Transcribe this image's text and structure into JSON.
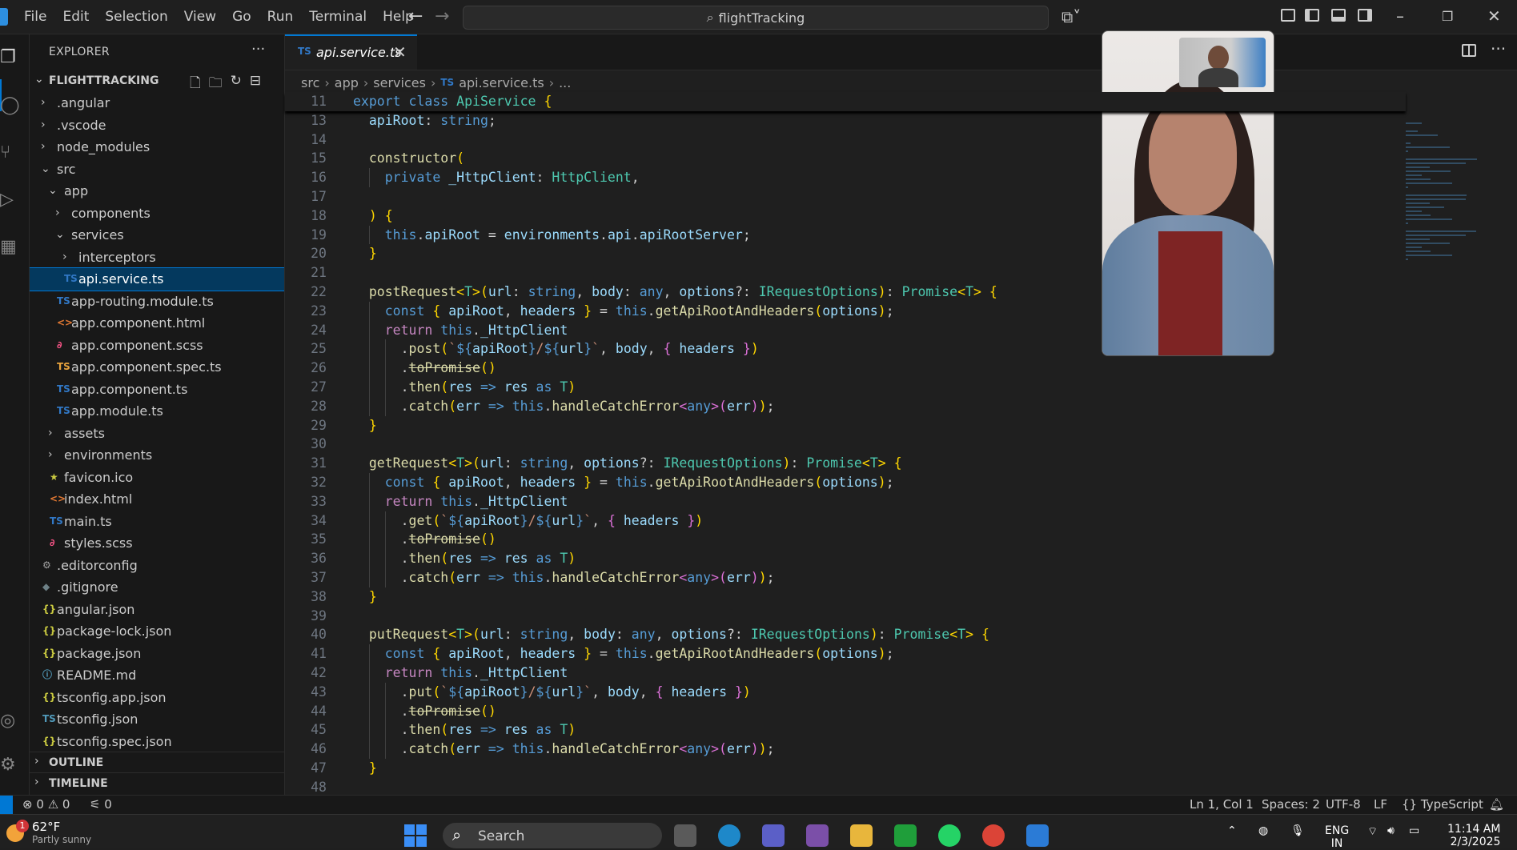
{
  "menu": [
    "File",
    "Edit",
    "Selection",
    "View",
    "Go",
    "Run",
    "Terminal",
    "Help"
  ],
  "command_center": {
    "text": "flightTracking"
  },
  "explorer": {
    "title": "EXPLORER",
    "root": "FLIGHTTRACKING",
    "items": [
      {
        "name": ".angular",
        "type": "folder",
        "depth": 1,
        "expanded": false
      },
      {
        "name": ".vscode",
        "type": "folder",
        "depth": 1,
        "expanded": false
      },
      {
        "name": "node_modules",
        "type": "folder",
        "depth": 1,
        "expanded": false
      },
      {
        "name": "src",
        "type": "folder",
        "depth": 1,
        "expanded": true
      },
      {
        "name": "app",
        "type": "folder",
        "depth": 2,
        "expanded": true
      },
      {
        "name": "components",
        "type": "folder",
        "depth": 3,
        "expanded": false
      },
      {
        "name": "services",
        "type": "folder",
        "depth": 3,
        "expanded": true
      },
      {
        "name": "interceptors",
        "type": "folder",
        "depth": 4,
        "expanded": false
      },
      {
        "name": "api.service.ts",
        "type": "ts",
        "depth": 4,
        "selected": true
      },
      {
        "name": "app-routing.module.ts",
        "type": "ts",
        "depth": 3
      },
      {
        "name": "app.component.html",
        "type": "html",
        "depth": 3
      },
      {
        "name": "app.component.scss",
        "type": "scss",
        "depth": 3
      },
      {
        "name": "app.component.spec.ts",
        "type": "spec",
        "depth": 3
      },
      {
        "name": "app.component.ts",
        "type": "ts",
        "depth": 3
      },
      {
        "name": "app.module.ts",
        "type": "ts",
        "depth": 3
      },
      {
        "name": "assets",
        "type": "folder",
        "depth": 2,
        "expanded": false
      },
      {
        "name": "environments",
        "type": "folder",
        "depth": 2,
        "expanded": false
      },
      {
        "name": "favicon.ico",
        "type": "ico",
        "depth": 2
      },
      {
        "name": "index.html",
        "type": "html",
        "depth": 2
      },
      {
        "name": "main.ts",
        "type": "ts",
        "depth": 2
      },
      {
        "name": "styles.scss",
        "type": "scss",
        "depth": 2
      },
      {
        "name": ".editorconfig",
        "type": "gear",
        "depth": 1
      },
      {
        "name": ".gitignore",
        "type": "git",
        "depth": 1
      },
      {
        "name": "angular.json",
        "type": "json",
        "depth": 1
      },
      {
        "name": "package-lock.json",
        "type": "json",
        "depth": 1
      },
      {
        "name": "package.json",
        "type": "json",
        "depth": 1
      },
      {
        "name": "README.md",
        "type": "info",
        "depth": 1
      },
      {
        "name": "tsconfig.app.json",
        "type": "json",
        "depth": 1
      },
      {
        "name": "tsconfig.json",
        "type": "tsconfig",
        "depth": 1
      },
      {
        "name": "tsconfig.spec.json",
        "type": "json",
        "depth": 1
      }
    ],
    "outline": "OUTLINE",
    "timeline": "TIMELINE"
  },
  "editor": {
    "tab": {
      "badge": "TS",
      "name": "api.service.ts"
    },
    "breadcrumb": [
      "src",
      "app",
      "services",
      "api.service.ts",
      "..."
    ],
    "sticky_line": {
      "n": "11",
      "code": "export class ApiService {"
    },
    "lines": [
      {
        "n": "13",
        "code": "  apiRoot: string;"
      },
      {
        "n": "14",
        "code": ""
      },
      {
        "n": "15",
        "code": "  constructor("
      },
      {
        "n": "16",
        "code": "    private _HttpClient: HttpClient,"
      },
      {
        "n": "17",
        "code": ""
      },
      {
        "n": "18",
        "code": "  ) {"
      },
      {
        "n": "19",
        "code": "    this.apiRoot = environments.api.apiRootServer;"
      },
      {
        "n": "20",
        "code": "  }"
      },
      {
        "n": "21",
        "code": ""
      },
      {
        "n": "22",
        "code": "  postRequest<T>(url: string, body: any, options?: IRequestOptions): Promise<T> {"
      },
      {
        "n": "23",
        "code": "    const { apiRoot, headers } = this.getApiRootAndHeaders(options);"
      },
      {
        "n": "24",
        "code": "    return this._HttpClient"
      },
      {
        "n": "25",
        "code": "      .post(`${apiRoot}/${url}`, body, { headers })"
      },
      {
        "n": "26",
        "code": "      .toPromise()"
      },
      {
        "n": "27",
        "code": "      .then(res => res as T)"
      },
      {
        "n": "28",
        "code": "      .catch(err => this.handleCatchError<any>(err));"
      },
      {
        "n": "29",
        "code": "  }"
      },
      {
        "n": "30",
        "code": ""
      },
      {
        "n": "31",
        "code": "  getRequest<T>(url: string, options?: IRequestOptions): Promise<T> {"
      },
      {
        "n": "32",
        "code": "    const { apiRoot, headers } = this.getApiRootAndHeaders(options);"
      },
      {
        "n": "33",
        "code": "    return this._HttpClient"
      },
      {
        "n": "34",
        "code": "      .get(`${apiRoot}/${url}`, { headers })"
      },
      {
        "n": "35",
        "code": "      .toPromise()"
      },
      {
        "n": "36",
        "code": "      .then(res => res as T)"
      },
      {
        "n": "37",
        "code": "      .catch(err => this.handleCatchError<any>(err));"
      },
      {
        "n": "38",
        "code": "  }"
      },
      {
        "n": "39",
        "code": ""
      },
      {
        "n": "40",
        "code": "  putRequest<T>(url: string, body: any, options?: IRequestOptions): Promise<T> {"
      },
      {
        "n": "41",
        "code": "    const { apiRoot, headers } = this.getApiRootAndHeaders(options);"
      },
      {
        "n": "42",
        "code": "    return this._HttpClient"
      },
      {
        "n": "43",
        "code": "      .put(`${apiRoot}/${url}`, body, { headers })"
      },
      {
        "n": "44",
        "code": "      .toPromise()"
      },
      {
        "n": "45",
        "code": "      .then(res => res as T)"
      },
      {
        "n": "46",
        "code": "      .catch(err => this.handleCatchError<any>(err));"
      },
      {
        "n": "47",
        "code": "  }"
      },
      {
        "n": "48",
        "code": ""
      }
    ]
  },
  "statusbar": {
    "errors": "0",
    "warnings": "0",
    "ports": "0",
    "position": "Ln 1, Col 1",
    "spaces": "Spaces: 2",
    "encoding": "UTF-8",
    "eol": "LF",
    "language": "TypeScript"
  },
  "taskbar": {
    "weather_temp": "62°F",
    "weather_cond": "Partly sunny",
    "weather_badge": "1",
    "search_placeholder": "Search",
    "lang": "ENG",
    "lang_sub": "IN",
    "time": "11:14 AM",
    "date": "2/3/2025"
  },
  "colors": {
    "accent": "#0078d4",
    "ts_badge": "#3178c6",
    "selection": "#04395e"
  },
  "icons": [
    "files-icon",
    "search-icon",
    "source-control-icon",
    "run-debug-icon",
    "extensions-icon",
    "account-icon",
    "settings-gear-icon"
  ]
}
